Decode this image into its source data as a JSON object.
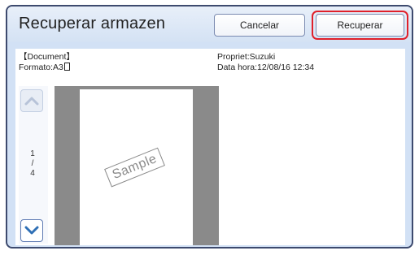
{
  "header": {
    "title": "Recuperar armazen",
    "cancel_label": "Cancelar",
    "recover_label": "Recuperar"
  },
  "details": {
    "document_label": "【Document】",
    "format_label": "Formato:A3",
    "owner_label": "Propriet:Suzuki",
    "datetime_label": "Data hora:12/08/16 12:34"
  },
  "pager": {
    "current": "1",
    "separator": "/",
    "total": "4"
  },
  "preview": {
    "stamp_text": "Sample"
  },
  "colors": {
    "accent": "#2f6fb5",
    "highlight": "#e0202a",
    "panel": "#d2e1f5"
  },
  "icons": {
    "up": "chevron-up-icon",
    "down": "chevron-down-icon",
    "page": "portrait-page-icon"
  }
}
